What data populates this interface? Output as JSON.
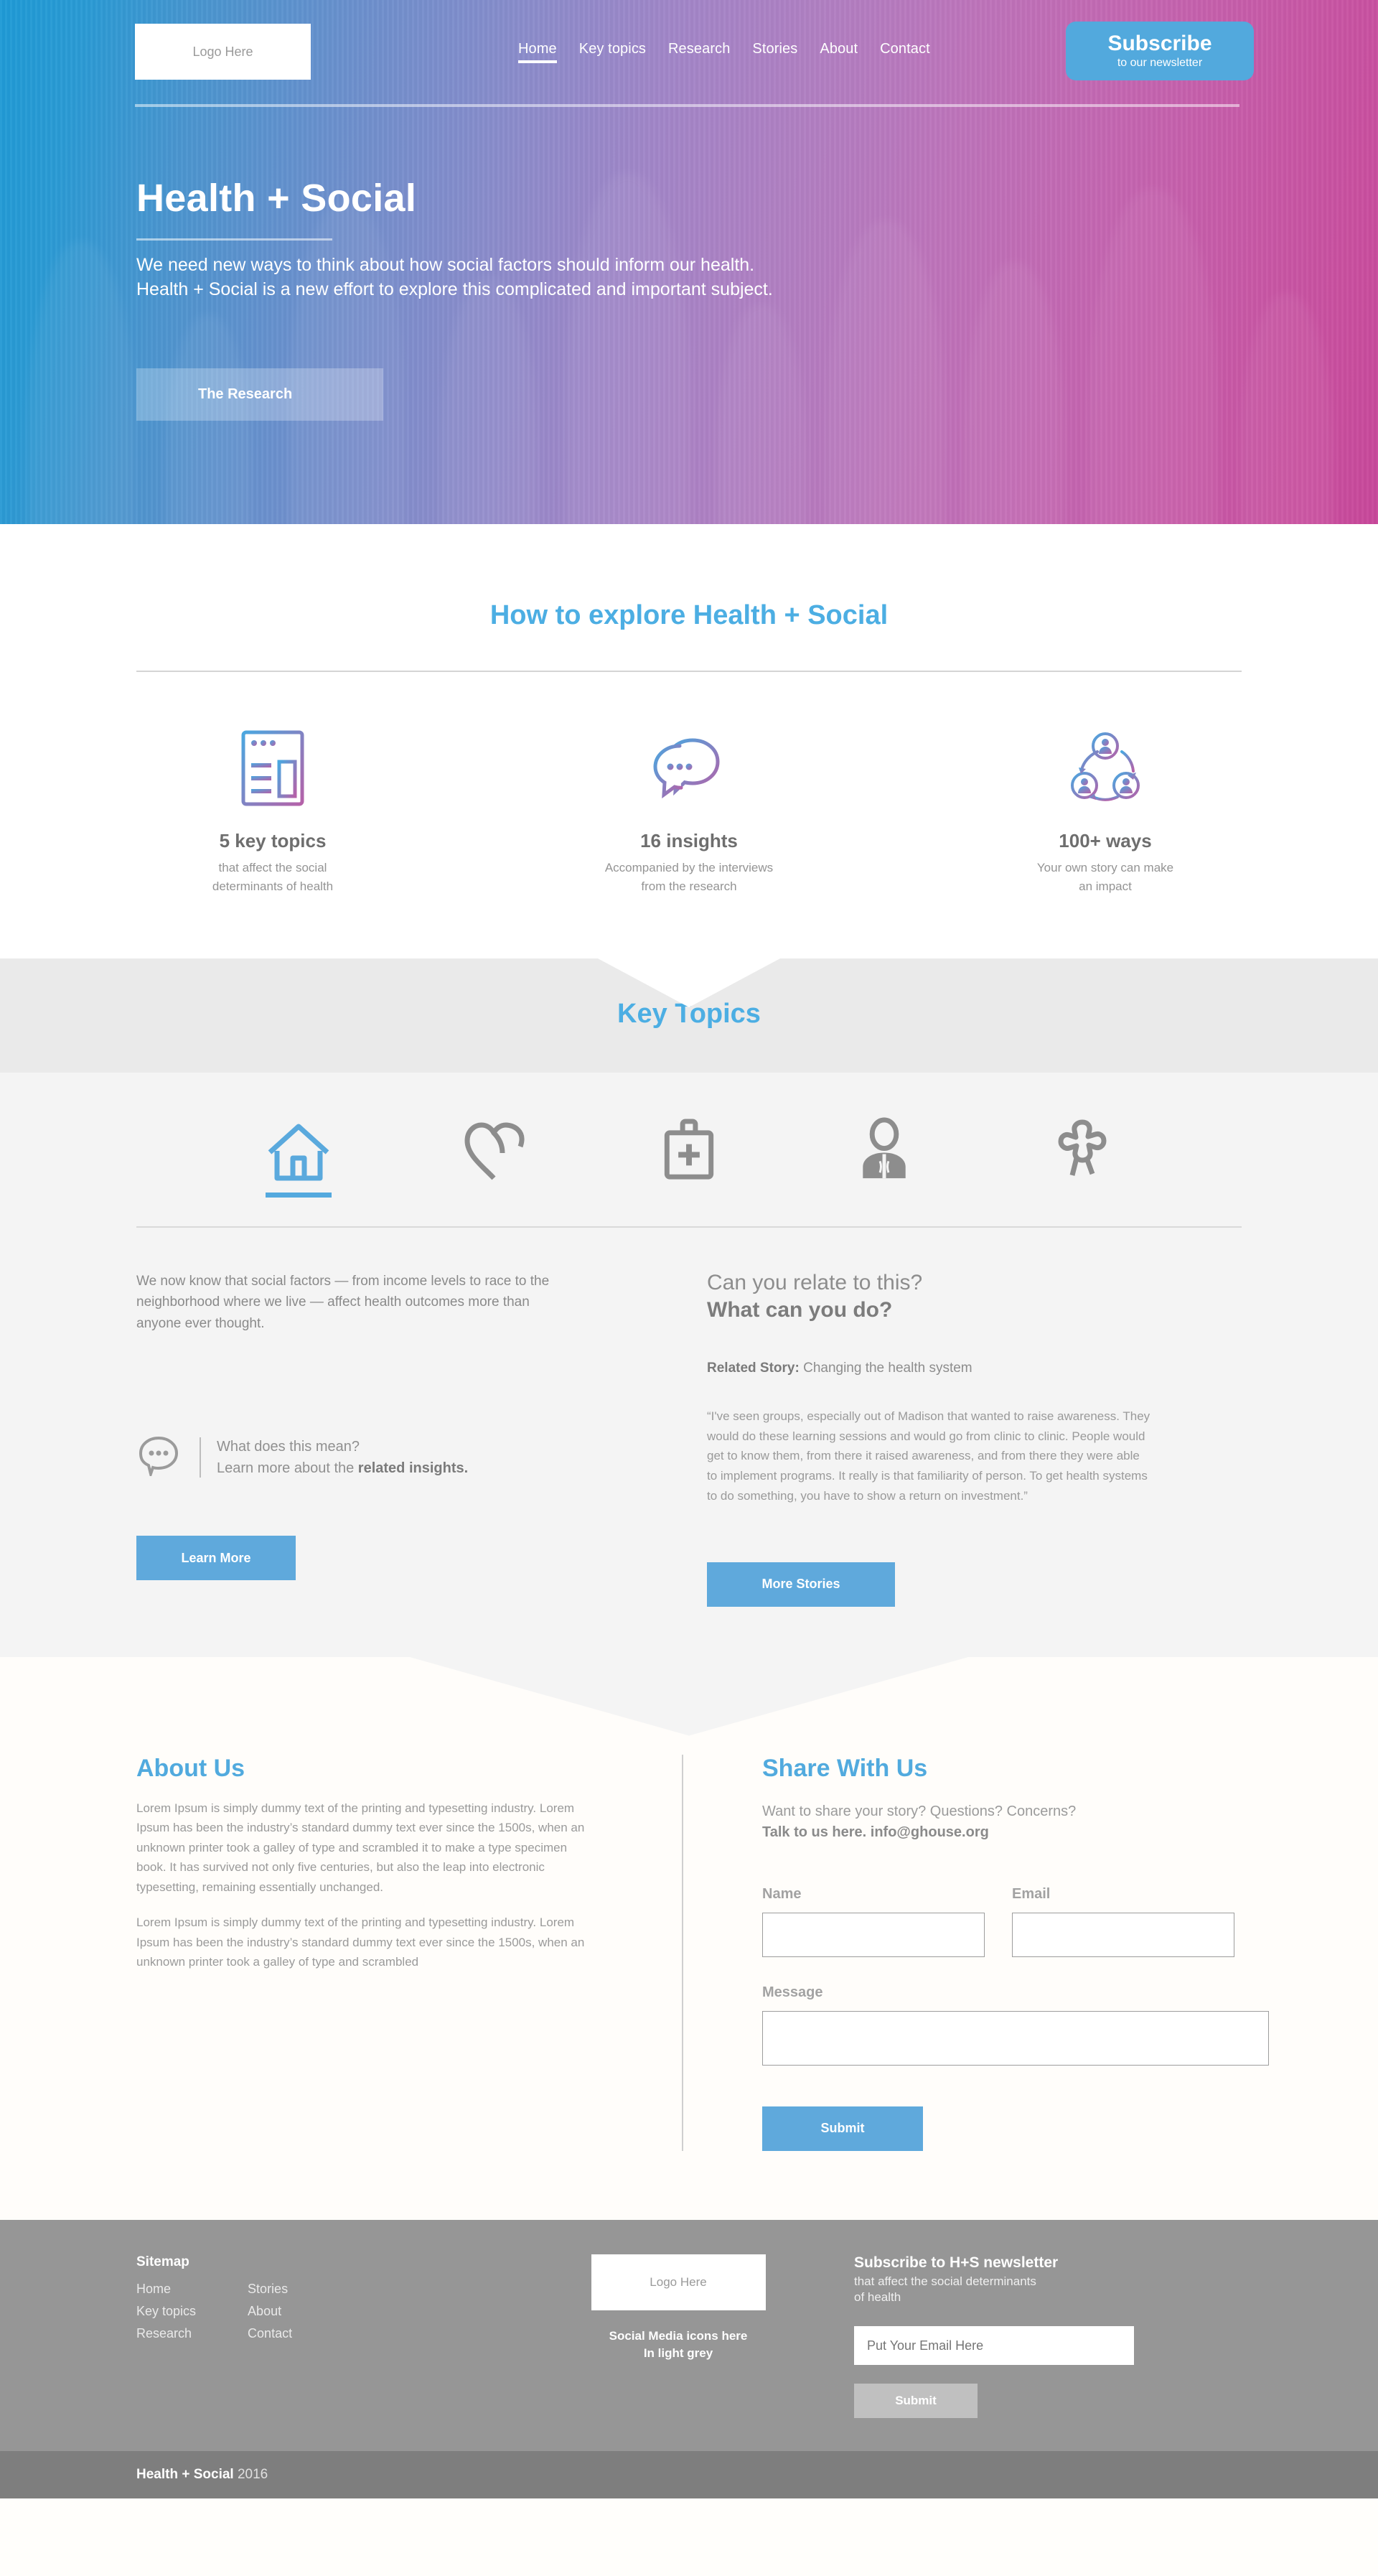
{
  "brand": {
    "logo_placeholder": "Logo Here"
  },
  "header": {
    "nav": [
      {
        "label": "Home",
        "active": true
      },
      {
        "label": "Key topics",
        "active": false
      },
      {
        "label": "Research",
        "active": false
      },
      {
        "label": "Stories",
        "active": false
      },
      {
        "label": "About",
        "active": false
      },
      {
        "label": "Contact",
        "active": false
      }
    ],
    "subscribe_title": "Subscribe",
    "subscribe_sub": "to our newsletter"
  },
  "hero": {
    "title": "Health + Social",
    "subtitle_line1": "We need new ways to think about how social factors should inform our health.",
    "subtitle_line2": "Health + Social is a new effort to explore this complicated and important subject.",
    "cta": "The Research",
    "gradient_start": "#1e9ad6",
    "gradient_end": "#c8479a"
  },
  "explore": {
    "title": "How to explore Health + Social",
    "stats": [
      {
        "icon": "browser-window-icon",
        "number": "5 key topics",
        "desc_line1": "that affect the social",
        "desc_line2": "determinants of health"
      },
      {
        "icon": "speech-bubbles-icon",
        "number": "16 insights",
        "desc_line1": "Accompanied by the interviews",
        "desc_line2": "from the research"
      },
      {
        "icon": "people-cycle-icon",
        "number": "100+ ways",
        "desc_line1": "Your own story can make",
        "desc_line2": "an impact"
      }
    ]
  },
  "key_topics": {
    "title": "Key Topics",
    "accent_color": "#54a9de",
    "icons": [
      {
        "name": "home-icon",
        "active": true
      },
      {
        "name": "heart-icon",
        "active": false
      },
      {
        "name": "medical-bag-icon",
        "active": false
      },
      {
        "name": "person-tie-icon",
        "active": false
      },
      {
        "name": "puzzle-piece-icon",
        "active": false
      }
    ],
    "lede": "We now know that social factors — from income levels to race to the neighborhood where we live — affect health outcomes more than anyone ever thought.",
    "insights_line1": "What does this mean?",
    "insights_line2_prefix": "Learn more about the ",
    "insights_line2_bold": "related insights.",
    "learn_more_label": "Learn More",
    "question_line1": "Can you relate to this?",
    "question_line2": "What can you do?",
    "related_label": "Related Story:",
    "related_title": "Changing the health system",
    "quote": "“I've seen groups, especially out of Madison that wanted to raise awareness. They would do these learning sessions and would go from clinic to clinic. People would get to know them, from there it raised awareness, and from there they were able to implement programs. It really is that familiarity of person. To get health systems to do something, you have to show a return on investment.”",
    "more_stories_label": "More Stories"
  },
  "about": {
    "title": "About Us",
    "paragraph1": "Lorem Ipsum is simply dummy text of the printing and typesetting industry. Lorem Ipsum has been the industry’s standard dummy text ever since the 1500s, when an unknown printer took a galley of type and scrambled it to make a type specimen book. It has survived not only five centuries, but also the leap into electronic typesetting, remaining essentially unchanged.",
    "paragraph2": "Lorem Ipsum is simply dummy text of the printing and typesetting industry. Lorem Ipsum has been the industry’s standard dummy text ever since the 1500s, when an unknown printer took a galley of type and scrambled"
  },
  "share": {
    "title": "Share With Us",
    "sub_line1": "Want to share your story? Questions? Concerns?",
    "sub_line2": "Talk to us here. info@ghouse.org",
    "name_label": "Name",
    "name_value": "",
    "email_label": "Email",
    "email_value": "",
    "message_label": "Message",
    "message_value": "",
    "submit_label": "Submit"
  },
  "footer": {
    "sitemap_title": "Sitemap",
    "links_col1": [
      "Home",
      "Key topics",
      "Research"
    ],
    "links_col2": [
      "Stories",
      "About",
      "Contact"
    ],
    "logo_placeholder": "Logo Here",
    "social_line1": "Social Media icons here",
    "social_line2": "In light grey",
    "newsletter_title": "Subscribe to H+S newsletter",
    "newsletter_sub_line1": "that affect the social determinants",
    "newsletter_sub_line2": "of health",
    "email_placeholder": "Put Your Email Here",
    "email_value": "",
    "submit_label": "Submit",
    "copyright_brand": "Health + Social",
    "copyright_year": "2016"
  }
}
